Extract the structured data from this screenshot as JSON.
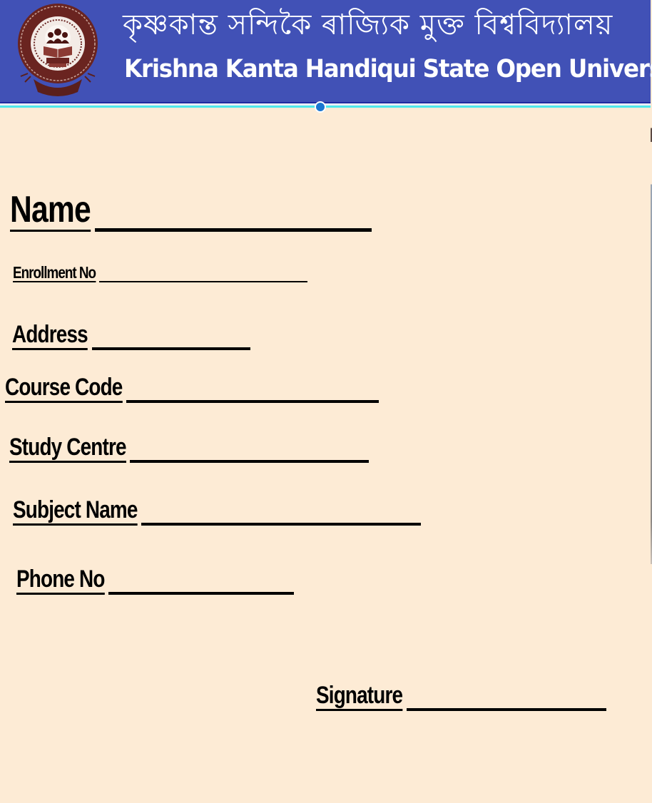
{
  "header": {
    "title_assamese": "কৃষ্ণকান্ত সন্দিকৈ ৰাজ্যিক মুক্ত বিশ্ববিদ্যালয়",
    "title_english": "Krishna Kanta Handiqui State Open University",
    "logo_icon": "university-seal-icon",
    "colors": {
      "header_bg": "#4151b6",
      "rule_cyan": "#4fe8ec",
      "handle": "#1b76d1",
      "page_bg": "#fdebd5"
    }
  },
  "form": {
    "fields": [
      {
        "id": "name",
        "label": "Name",
        "value": ""
      },
      {
        "id": "enrollment_no",
        "label": "Enrollment No",
        "value": ""
      },
      {
        "id": "address",
        "label": "Address",
        "value": ""
      },
      {
        "id": "course_code",
        "label": "Course Code",
        "value": ""
      },
      {
        "id": "study_centre",
        "label": "Study Centre",
        "value": ""
      },
      {
        "id": "subject_name",
        "label": "Subject Name",
        "value": ""
      },
      {
        "id": "phone_no",
        "label": "Phone No",
        "value": ""
      },
      {
        "id": "signature",
        "label": "Signature",
        "value": ""
      }
    ]
  }
}
